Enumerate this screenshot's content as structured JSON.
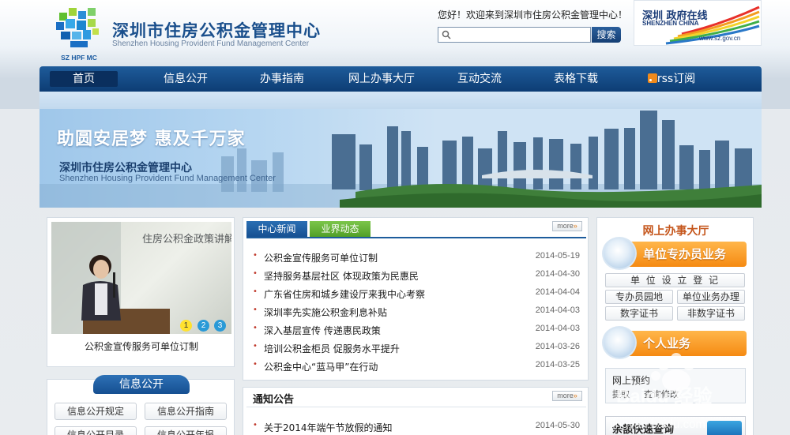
{
  "header": {
    "title": "深圳市住房公积金管理中心",
    "subtitle": "Shenzhen Housing Provident Fund Management Center",
    "logo_caption": "SZ HPF MC",
    "welcome": "您好！欢迎来到深圳市住房公积金管理中心！",
    "search_placeholder": "",
    "search_button": "搜索",
    "gov_logo": {
      "line1": "深圳 政府在线",
      "line2": "SHENZHEN CHINA",
      "url": "www.sz.gov.cn"
    }
  },
  "nav": {
    "items": [
      "首页",
      "信息公开",
      "办事指南",
      "网上办事大厅",
      "互动交流",
      "表格下载",
      "rss订阅"
    ],
    "active_index": 0
  },
  "banner": {
    "slogan": "助圆安居梦 惠及千万家",
    "title": "深圳市住房公积金管理中心",
    "subtitle": "Shenzhen Housing Provident Fund Management Center"
  },
  "slideshow": {
    "photo_sign": "住房公积金政策讲解",
    "dots": [
      "1",
      "2",
      "3"
    ],
    "active_dot": 0,
    "caption": "公积金宣传服务可单位订制"
  },
  "info_public": {
    "title": "信息公开",
    "links": [
      "信息公开规定",
      "信息公开指南",
      "信息公开目录",
      "信息公开年报"
    ]
  },
  "news": {
    "tabs": [
      "中心新闻",
      "业界动态"
    ],
    "more": "more",
    "items": [
      {
        "title": "公积金宣传服务可单位订制",
        "date": "2014-05-19"
      },
      {
        "title": "坚持服务基层社区 体现政策为民惠民",
        "date": "2014-04-30"
      },
      {
        "title": "广东省住房和城乡建设厅来我中心考察",
        "date": "2014-04-04"
      },
      {
        "title": "深圳率先实施公积金利息补贴",
        "date": "2014-04-03"
      },
      {
        "title": "深入基层宣传 传递惠民政策",
        "date": "2014-04-03"
      },
      {
        "title": "培训公积金柜员 促服务水平提升",
        "date": "2014-03-26"
      },
      {
        "title": "公积金中心“蓝马甲”在行动",
        "date": "2014-03-25"
      }
    ]
  },
  "notice": {
    "title": "通知公告",
    "more": "more",
    "items": [
      {
        "title": "关于2014年端午节放假的通知",
        "date": "2014-05-30"
      }
    ]
  },
  "online_hall": {
    "title": "网上办事大厅",
    "unit_button": "单位专办员业务",
    "unit_links": [
      "单 位 设 立 登 记",
      "专办员园地",
      "单位业务办理",
      "数字证书",
      "非数字证书"
    ],
    "personal_button": "个人业务",
    "personal_links": [
      "网上预约",
      "提取",
      "查询修改"
    ],
    "balance_query": "余额快速查询"
  },
  "watermark": {
    "text": "Baidu 经验",
    "url": "jingyan.baidu.com"
  },
  "colors": {
    "nav_blue": "#1e5b9a",
    "orange": "#f58a12",
    "green_tab": "#5aa82e"
  }
}
